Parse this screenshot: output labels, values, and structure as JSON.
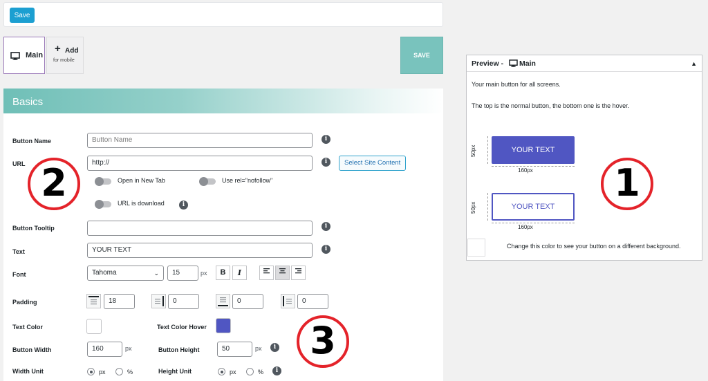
{
  "toolbar": {
    "save_label": "Save"
  },
  "tabs": {
    "main_label": "Main",
    "add_label": "Add",
    "add_sub": "for mobile"
  },
  "save_big_label": "SAVE",
  "section": {
    "title": "Basics"
  },
  "fields": {
    "button_name": {
      "label": "Button Name",
      "placeholder": "Button Name"
    },
    "url": {
      "label": "URL",
      "value": "http://",
      "select_label": "Select Site Content"
    },
    "open_new_tab": "Open in New Tab",
    "nofollow": "Use rel=\"nofollow\"",
    "is_download": "URL is download",
    "tooltip": {
      "label": "Button Tooltip",
      "value": ""
    },
    "text": {
      "label": "Text",
      "value": "YOUR TEXT"
    },
    "font": {
      "label": "Font",
      "family": "Tahoma",
      "size": "15",
      "unit": "px"
    },
    "format": {
      "bold": "B",
      "italic": "I"
    },
    "padding": {
      "label": "Padding",
      "values": [
        "18",
        "0",
        "0",
        "0"
      ]
    },
    "text_color": {
      "label": "Text Color",
      "hover_label": "Text Color Hover",
      "color": "#ffffff",
      "hover_color": "#5056c2"
    },
    "button_width": {
      "label": "Button Width",
      "value": "160",
      "unit": "px"
    },
    "button_height": {
      "label": "Button Height",
      "value": "50",
      "unit": "px"
    },
    "width_unit": {
      "label": "Width Unit",
      "options": [
        "px",
        "%"
      ],
      "selected": "px"
    },
    "height_unit": {
      "label": "Height Unit",
      "options": [
        "px",
        "%"
      ],
      "selected": "px"
    }
  },
  "preview": {
    "title": "Preview -",
    "main": "Main",
    "line1": "Your main button for all screens.",
    "line2": "The top is the normal button, the bottom one is the hover.",
    "button_text": "YOUR TEXT",
    "width_label": "160px",
    "height_label": "50px",
    "bg_note": "Change this color to see your button on a different background.",
    "button_color": "#5056c2"
  },
  "badges": [
    "1",
    "2",
    "3"
  ],
  "icons": [
    "desktop-icon",
    "plus-icon",
    "info-icon",
    "chevron-down-icon",
    "align-left-icon",
    "align-center-icon",
    "align-right-icon",
    "padding-icon",
    "triangle-up-icon"
  ]
}
